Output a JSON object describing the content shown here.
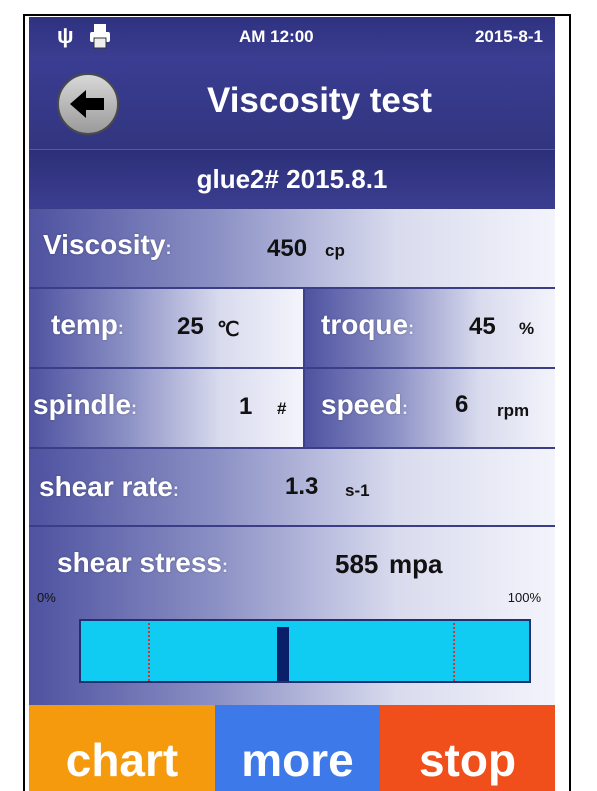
{
  "status": {
    "time": "AM 12:00",
    "date": "2015-8-1",
    "usb_icon": "usb-icon",
    "printer_icon": "printer-icon"
  },
  "header": {
    "title": "Viscosity test",
    "back_icon": "arrow-left-icon",
    "subtitle": "glue2# 2015.8.1"
  },
  "viscosity": {
    "label": "Viscosity",
    "colon": ":",
    "value": "450",
    "unit": "cp"
  },
  "temp": {
    "label": "temp",
    "colon": ":",
    "value": "25",
    "unit": "℃"
  },
  "troque": {
    "label": "troque",
    "colon": ":",
    "value": "45",
    "unit": "%"
  },
  "spindle": {
    "label": "spindle",
    "colon": ":",
    "value": "1",
    "unit": "#"
  },
  "speed": {
    "label": "speed",
    "colon": ":",
    "value": "6",
    "unit": "rpm"
  },
  "shear_rate": {
    "label": "shear rate",
    "colon": ":",
    "value": "1.3",
    "unit": "s-1"
  },
  "shear_stress": {
    "label": "shear stress",
    "colon": ":",
    "value": "585",
    "unit": "mpa"
  },
  "gauge": {
    "min_label": "0%",
    "max_label": "100%",
    "level": 0.45,
    "low_limit": 0.15,
    "high_limit": 0.83,
    "track_color": "#10ccf2",
    "needle_color": "#0a1f6a",
    "limit_color": "#e03030"
  },
  "buttons": [
    {
      "label": "chart",
      "color": "#f59a0c"
    },
    {
      "label": "more",
      "color": "#3d79e8"
    },
    {
      "label": "stop",
      "color": "#f04e1a"
    }
  ]
}
